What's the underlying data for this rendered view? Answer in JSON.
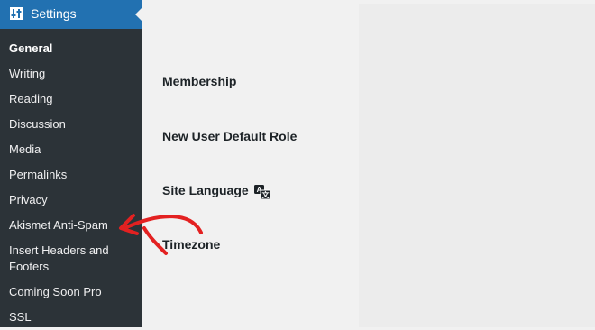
{
  "sidebar": {
    "header_label": "Settings",
    "items": [
      {
        "label": "General"
      },
      {
        "label": "Writing"
      },
      {
        "label": "Reading"
      },
      {
        "label": "Discussion"
      },
      {
        "label": "Media"
      },
      {
        "label": "Permalinks"
      },
      {
        "label": "Privacy"
      },
      {
        "label": "Akismet Anti-Spam"
      },
      {
        "label": "Insert Headers and Footers"
      },
      {
        "label": "Coming Soon Pro"
      },
      {
        "label": "SSL"
      }
    ]
  },
  "main": {
    "rows": [
      {
        "label": "Membership"
      },
      {
        "label": "New User Default Role"
      },
      {
        "label": "Site Language"
      },
      {
        "label": "Timezone"
      }
    ]
  },
  "colors": {
    "sidebar_bg": "#2c3338",
    "header_bg": "#2271b1",
    "content_bg": "#f1f1f1",
    "arrow": "#e32121"
  },
  "icons": {
    "header": "settings-sliders-icon",
    "language": "translate-icon",
    "annotation": "red-arrow-annotation"
  }
}
